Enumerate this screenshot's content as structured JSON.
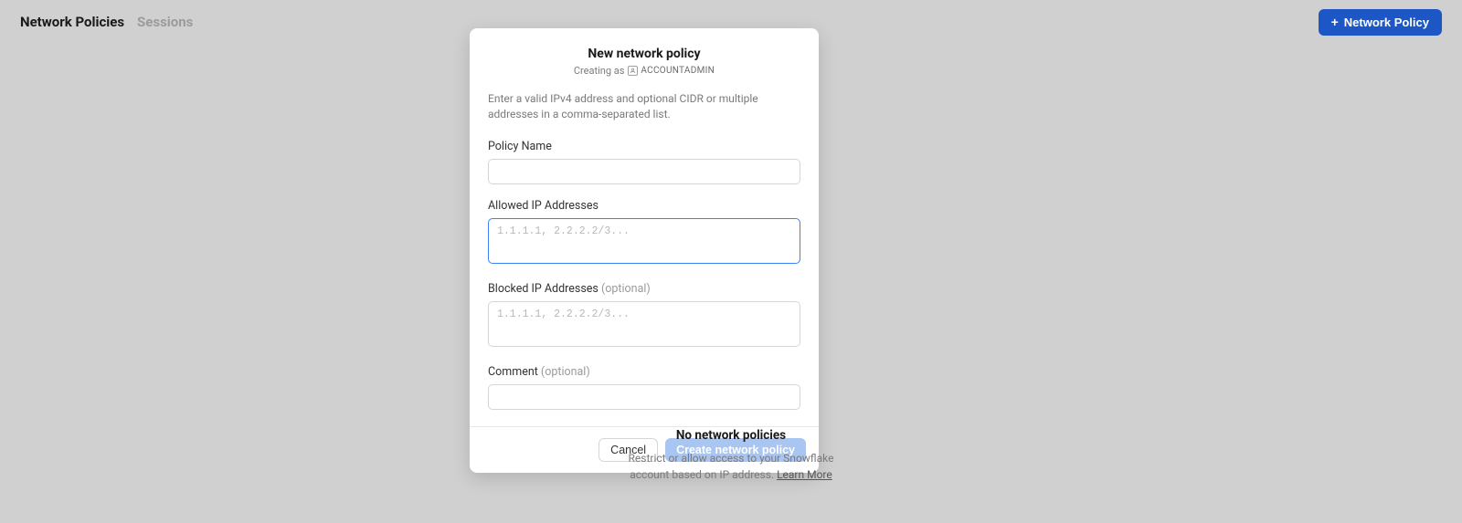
{
  "topbar": {
    "tabs": {
      "network_policies": "Network Policies",
      "sessions": "Sessions"
    },
    "new_button": "Network Policy"
  },
  "modal": {
    "title": "New network policy",
    "subtitle_prefix": "Creating as",
    "role": "ACCOUNTADMIN",
    "help": "Enter a valid IPv4 address and optional CIDR or multiple addresses in a comma-separated list.",
    "fields": {
      "policy_name": {
        "label": "Policy Name",
        "value": ""
      },
      "allowed_ip": {
        "label": "Allowed IP Addresses",
        "placeholder": "1.1.1.1, 2.2.2.2/3...",
        "value": ""
      },
      "blocked_ip": {
        "label": "Blocked IP Addresses",
        "optional": "(optional)",
        "placeholder": "1.1.1.1, 2.2.2.2/3...",
        "value": ""
      },
      "comment": {
        "label": "Comment",
        "optional": "(optional)",
        "value": ""
      }
    },
    "footer": {
      "cancel": "Cancel",
      "create": "Create network policy"
    }
  },
  "empty": {
    "title": "No network policies",
    "desc1": "Restrict or allow access to your Snowflake",
    "desc2": "account based on IP address.",
    "link": "Learn More"
  }
}
